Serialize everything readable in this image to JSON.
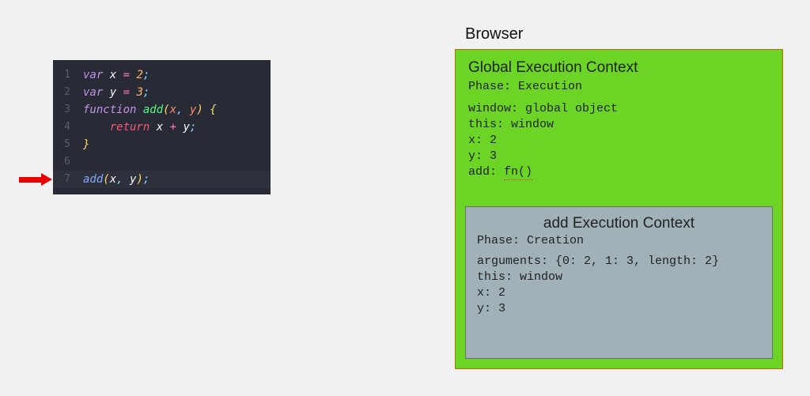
{
  "code": {
    "lines": [
      "1",
      "2",
      "3",
      "4",
      "5",
      "6",
      "7"
    ],
    "l1_kw": "var",
    "l1_sp": " ",
    "l1_id": "x",
    "l1_eq": " = ",
    "l1_num": "2",
    "l1_semi": ";",
    "l2_kw": "var",
    "l2_sp": " ",
    "l2_id": "y",
    "l2_eq": " = ",
    "l2_num": "3",
    "l2_semi": ";",
    "l3_kw": "function ",
    "l3_name": "add",
    "l3_po": "(",
    "l3_p1": "x",
    "l3_comma": ", ",
    "l3_p2": "y",
    "l3_pc": ") ",
    "l3_brace": "{",
    "l4_indent": "    ",
    "l4_ret": "return",
    "l4_sp": " ",
    "l4_x": "x",
    "l4_plus": " + ",
    "l4_y": "y",
    "l4_semi": ";",
    "l5_brace": "}",
    "l7_call": "add",
    "l7_po": "(",
    "l7_x": "x",
    "l7_comma": ", ",
    "l7_y": "y",
    "l7_pc": ")",
    "l7_semi": ";"
  },
  "browserLabel": "Browser",
  "global": {
    "title": "Global Execution Context",
    "phaseLabel": "Phase: ",
    "phase": "Execution",
    "winLabel": "window: ",
    "winVal": "global object",
    "thisLabel": "this: ",
    "thisVal": "window",
    "xLabel": "x: ",
    "xVal": "2",
    "yLabel": "y: ",
    "yVal": "3",
    "addLabel": "add: ",
    "addVal": "fn()"
  },
  "addctx": {
    "title": "add Execution Context",
    "phaseLabel": "Phase: ",
    "phase": "Creation",
    "argsLabel": "arguments: ",
    "argsVal": "{0: 2, 1: 3, length: 2}",
    "thisLabel": "this: ",
    "thisVal": "window",
    "xLabel": "x: ",
    "xVal": "2",
    "yLabel": "y: ",
    "yVal": "3"
  }
}
